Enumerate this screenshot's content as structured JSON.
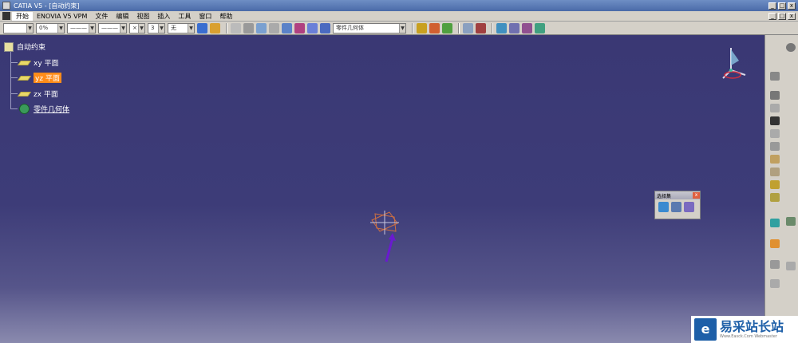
{
  "titlebar": {
    "title": "CATIA V5 - [自动约束]",
    "buttons": [
      "_",
      "□",
      "x"
    ]
  },
  "menubar": {
    "items": [
      "开始",
      "ENOVIA V5 VPM",
      "文件",
      "编辑",
      "视图",
      "插入",
      "工具",
      "窗口",
      "帮助"
    ],
    "doc_buttons": [
      "_",
      "□",
      "x"
    ]
  },
  "toolbar": {
    "combo_color": "",
    "combo_transparency": "0%",
    "combo_thickness": "———",
    "combo_linetype": "———",
    "combo_point": "×",
    "combo_layer_num": "3",
    "combo_none": "无",
    "combo_workobj": "零件几何体"
  },
  "tree": {
    "root": "自动约束",
    "nodes": [
      "xy 平面",
      "yz 平面",
      "zx 平面",
      "零件几何体"
    ]
  },
  "float_toolbar": {
    "title": "选择集"
  },
  "watermark": {
    "logo": "e",
    "title": "易采站长站",
    "sub": "Www.Easck.Com  Webmaster"
  },
  "colors": {
    "viewport": "#3b3a72",
    "selection": "#ff8c1a",
    "chrome": "#d4d0c8"
  }
}
